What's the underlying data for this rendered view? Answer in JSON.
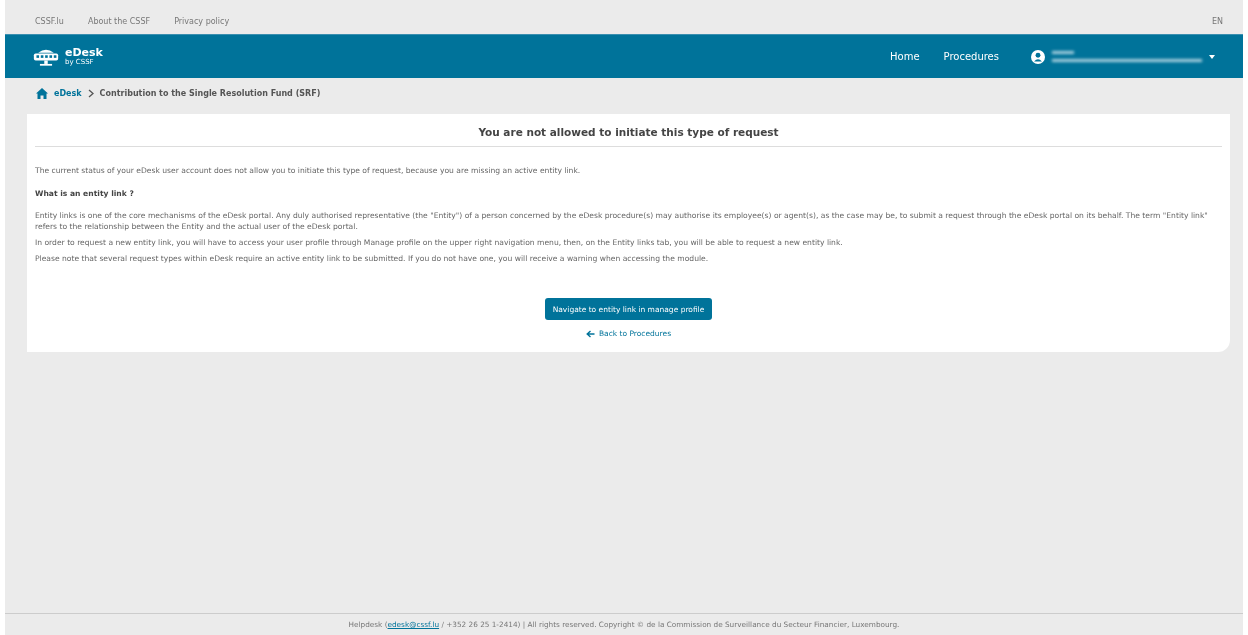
{
  "top_links": [
    "CSSF.lu",
    "About the CSSF",
    "Privacy policy"
  ],
  "language": "EN",
  "brand": {
    "name": "eDesk",
    "sub": "by CSSF"
  },
  "nav": [
    "Home",
    "Procedures"
  ],
  "breadcrumb": {
    "home": "eDesk",
    "current": "Contribution to the Single Resolution Fund (SRF)"
  },
  "card": {
    "title": "You are not allowed to initiate this type of request",
    "intro": "The current status of your eDesk user account does not allow you to initiate this type of request, because you are missing an active entity link.",
    "heading": "What is an entity link ?",
    "paragraphs": [
      "Entity links is one of the core mechanisms of the eDesk portal. Any duly authorised representative (the \"Entity\") of a person concerned by the eDesk procedure(s) may authorise its employee(s) or agent(s), as the case may be, to submit a request through the eDesk portal on its behalf. The term \"Entity link\" refers to the relationship between the Entity and the actual user of the eDesk portal.",
      "In order to request a new entity link, you will have to access your user profile through Manage profile on the upper right navigation menu, then, on the Entity links tab, you will be able to request a new entity link.",
      "Please note that several request types within eDesk require an active entity link to be submitted. If you do not have one, you will receive a warning when accessing the module."
    ],
    "button": "Navigate to entity link in manage profile",
    "back_link": "Back to Procedures"
  },
  "footer": {
    "prefix": "Helpdesk (",
    "email": "edesk@cssf.lu",
    "suffix": " / +352 26 25 1-2414) | All rights reserved. Copyright © de la Commission de Surveillance du Secteur Financier, Luxembourg."
  }
}
